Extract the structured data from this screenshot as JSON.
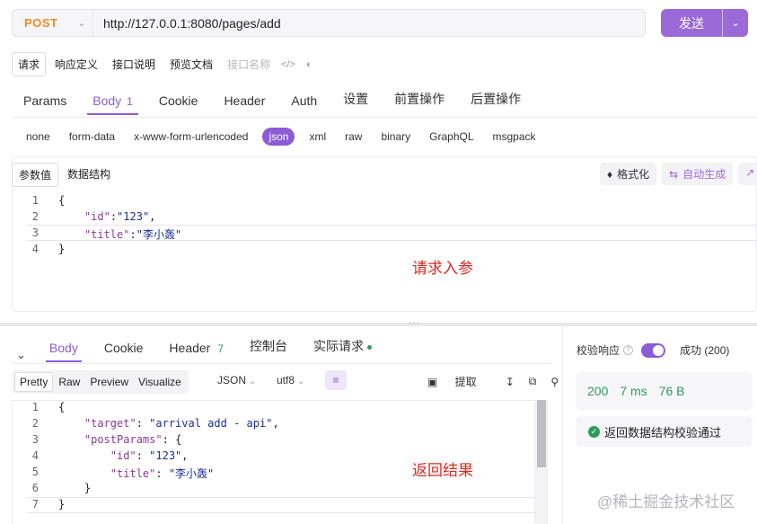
{
  "request": {
    "method": "POST",
    "url": "http://127.0.0.1:8080/pages/add",
    "send_label": "发送"
  },
  "doc_tabs": [
    "请求",
    "响应定义",
    "接口说明",
    "预览文档"
  ],
  "api_name_placeholder": "接口名称",
  "req_tabs": [
    {
      "label": "Params"
    },
    {
      "label": "Body",
      "badge": "1"
    },
    {
      "label": "Cookie"
    },
    {
      "label": "Header"
    },
    {
      "label": "Auth"
    },
    {
      "label": "设置"
    },
    {
      "label": "前置操作"
    },
    {
      "label": "后置操作"
    }
  ],
  "body_formats": [
    "none",
    "form-data",
    "x-www-form-urlencoded",
    "json",
    "xml",
    "raw",
    "binary",
    "GraphQL",
    "msgpack"
  ],
  "body_sub_tabs": [
    "参数值",
    "数据结构"
  ],
  "body_tools": {
    "format": "格式化",
    "auto_generate": "自动生成"
  },
  "request_code": {
    "line_numbers": [
      "1",
      "2",
      "3",
      "4"
    ],
    "lines": [
      {
        "plain": "{"
      },
      {
        "indent": "    ",
        "key": "\"id\"",
        "sep": ":",
        "value": "\"123\"",
        "tail": ","
      },
      {
        "indent": "    ",
        "key": "\"title\"",
        "sep": ":",
        "value": "\"李小轰\"",
        "tail": ""
      },
      {
        "plain": "}"
      }
    ]
  },
  "annotation_request": "请求入参",
  "resp_tabs": [
    {
      "label": "Body"
    },
    {
      "label": "Cookie"
    },
    {
      "label": "Header",
      "badge": "7"
    },
    {
      "label": "控制台"
    },
    {
      "label": "实际请求"
    }
  ],
  "view_modes": [
    "Pretty",
    "Raw",
    "Preview",
    "Visualize"
  ],
  "resp_format": "JSON",
  "resp_encoding": "utf8",
  "resp_extract": "提取",
  "response_code": {
    "line_numbers": [
      "1",
      "2",
      "3",
      "4",
      "5",
      "6",
      "7"
    ],
    "lines": [
      {
        "plain": "{"
      },
      {
        "indent": "    ",
        "key": "\"target\"",
        "sep": ": ",
        "value": "\"arrival add - api\"",
        "tail": ","
      },
      {
        "indent": "    ",
        "key": "\"postParams\"",
        "sep": ": ",
        "value": "",
        "tail": "{"
      },
      {
        "indent": "        ",
        "key": "\"id\"",
        "sep": ": ",
        "value": "\"123\"",
        "tail": ","
      },
      {
        "indent": "        ",
        "key": "\"title\"",
        "sep": ": ",
        "value": "\"李小轰\"",
        "tail": ""
      },
      {
        "plain": "    }"
      },
      {
        "plain": "}"
      }
    ]
  },
  "annotation_response": "返回结果",
  "validation": {
    "label": "校验响应",
    "question": "?",
    "result": "成功 (200)",
    "status": "200",
    "time": "7 ms",
    "size": "76 B",
    "pass_message": "返回数据结构校验通过"
  },
  "watermark": "@稀土掘金技术社区",
  "colors": {
    "accent": "#8b5cd6",
    "method": "#f08a24",
    "success": "#2e9b5c",
    "annotation": "#e0281e"
  }
}
